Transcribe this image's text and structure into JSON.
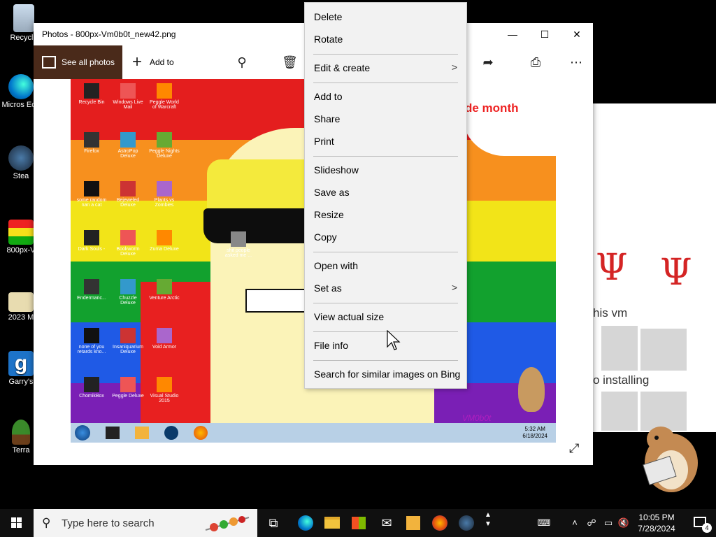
{
  "desktop": {
    "icons": [
      {
        "label": "Recycle"
      },
      {
        "label": "Micros Edg"
      },
      {
        "label": "Stea"
      },
      {
        "label": "800px-V"
      },
      {
        "label": "2023 M"
      },
      {
        "label": "Garry's"
      },
      {
        "label": "Terra"
      }
    ],
    "bg_window": {
      "text1": "his vm",
      "text2": "o installing",
      "tally": "Ψ"
    }
  },
  "photos": {
    "title": "Photos - 800px-Vm0b0t_new42.png",
    "toolbar": {
      "see_all": "See all photos",
      "add_to": "Add to"
    },
    "image": {
      "bubble_text": "de month",
      "signature": "VM0b0t",
      "inner_clock_time": "5:32 AM",
      "inner_clock_date": "6/18/2024",
      "icons": [
        "Recycle Bin",
        "Windows Live Mail",
        "Peggle World of Warcraft",
        "Firefox",
        "AstroPop Deluxe",
        "Peggle Nights Deluxe",
        "some random nan a cat",
        "Bejeweled Deluxe",
        "Plants vs Zombies",
        "Dark Souls -",
        "Bookworm Deluxe",
        "Zuma Deluxe",
        "Endermanc...",
        "Chuzzle Deluxe",
        "Venture Arctic",
        "none of you retards kno...",
        "Insaniquarium Deluxe",
        "Void Armor",
        "ChomikBox",
        "Peggle Deluxe",
        "Visual Studio 2015"
      ],
      "folder_label": "shit people asked me ..."
    }
  },
  "context_menu": {
    "items": [
      {
        "label": "Delete"
      },
      {
        "label": "Rotate"
      },
      {
        "label": "Edit & create",
        "chevron": ">"
      },
      {
        "label": "Add to"
      },
      {
        "label": "Share"
      },
      {
        "label": "Print"
      },
      {
        "label": "Slideshow"
      },
      {
        "label": "Save as"
      },
      {
        "label": "Resize"
      },
      {
        "label": "Copy"
      },
      {
        "label": "Open with"
      },
      {
        "label": "Set as",
        "chevron": ">"
      },
      {
        "label": "View actual size"
      },
      {
        "label": "File info"
      },
      {
        "label": "Search for similar images on Bing"
      }
    ]
  },
  "taskbar": {
    "search_placeholder": "Type here to search",
    "time": "10:05 PM",
    "date": "7/28/2024",
    "notification_count": "4",
    "accent": "#0078d7"
  },
  "colors": {
    "stripe_red": "#e41e1e",
    "stripe_orange": "#f7901e",
    "stripe_yellow": "#f2e418",
    "stripe_green": "#12a12e",
    "stripe_blue": "#1f5ae6",
    "stripe_purple": "#7a1fb5"
  }
}
